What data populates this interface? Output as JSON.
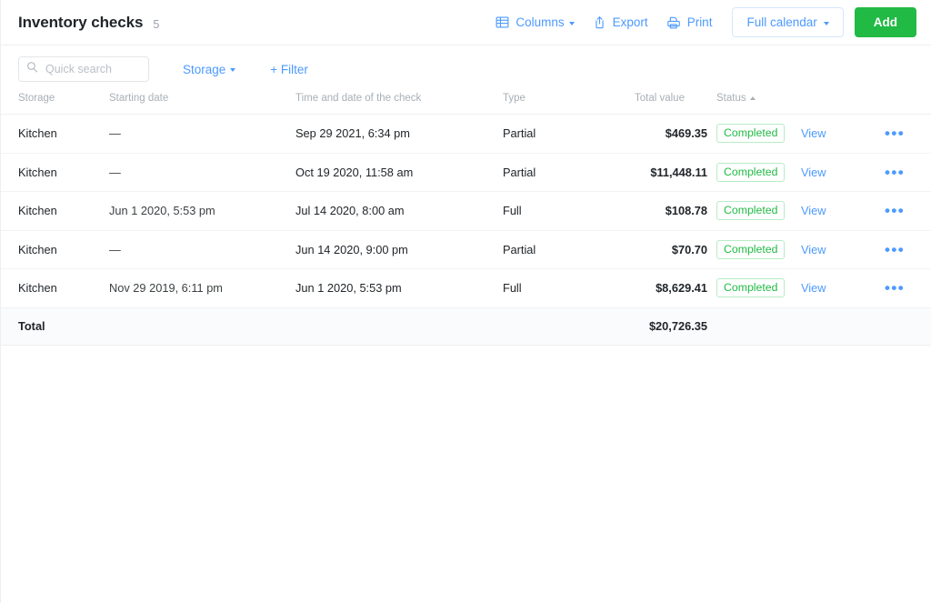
{
  "header": {
    "title": "Inventory checks",
    "count": "5",
    "actions": {
      "columns_label": "Columns",
      "columns_icon": "table-grid-icon",
      "export_label": "Export",
      "export_icon": "upload-arrow-icon",
      "print_label": "Print",
      "print_icon": "printer-icon",
      "full_calendar_label": "Full calendar",
      "add_label": "Add"
    }
  },
  "filters": {
    "search_placeholder": "Quick search",
    "search_value": "",
    "search_icon": "search-icon",
    "storage_label": "Storage",
    "add_filter_label": "+ Filter"
  },
  "table": {
    "columns": [
      "Storage",
      "Starting date",
      "Time and date of the check",
      "Type",
      "Total value",
      "Status"
    ],
    "sort": {
      "column": "Status",
      "direction": "asc"
    },
    "row_action_label": "View",
    "row_menu_icon": "ellipsis-icon",
    "rows": [
      {
        "storage": "Kitchen",
        "starting_date": "—",
        "check_datetime": "Sep 29 2021, 6:34 pm",
        "type": "Partial",
        "total_value": "$469.35",
        "status": "Completed"
      },
      {
        "storage": "Kitchen",
        "starting_date": "—",
        "check_datetime": "Oct 19 2020, 11:58 am",
        "type": "Partial",
        "total_value": "$11,448.11",
        "status": "Completed"
      },
      {
        "storage": "Kitchen",
        "starting_date": "Jun 1 2020, 5:53 pm",
        "check_datetime": "Jul 14 2020, 8:00 am",
        "type": "Full",
        "total_value": "$108.78",
        "status": "Completed"
      },
      {
        "storage": "Kitchen",
        "starting_date": "—",
        "check_datetime": "Jun 14 2020, 9:00 pm",
        "type": "Partial",
        "total_value": "$70.70",
        "status": "Completed"
      },
      {
        "storage": "Kitchen",
        "starting_date": "Nov 29 2019, 6:11 pm",
        "check_datetime": "Jun 1 2020, 5:53 pm",
        "type": "Full",
        "total_value": "$8,629.41",
        "status": "Completed"
      }
    ],
    "total": {
      "label": "Total",
      "value": "$20,726.35"
    }
  },
  "colors": {
    "accent_blue": "#4c9aff",
    "success_green": "#21ba45",
    "badge_border": "#b7ecc5",
    "text": "#212529",
    "muted": "#a8afb6"
  }
}
